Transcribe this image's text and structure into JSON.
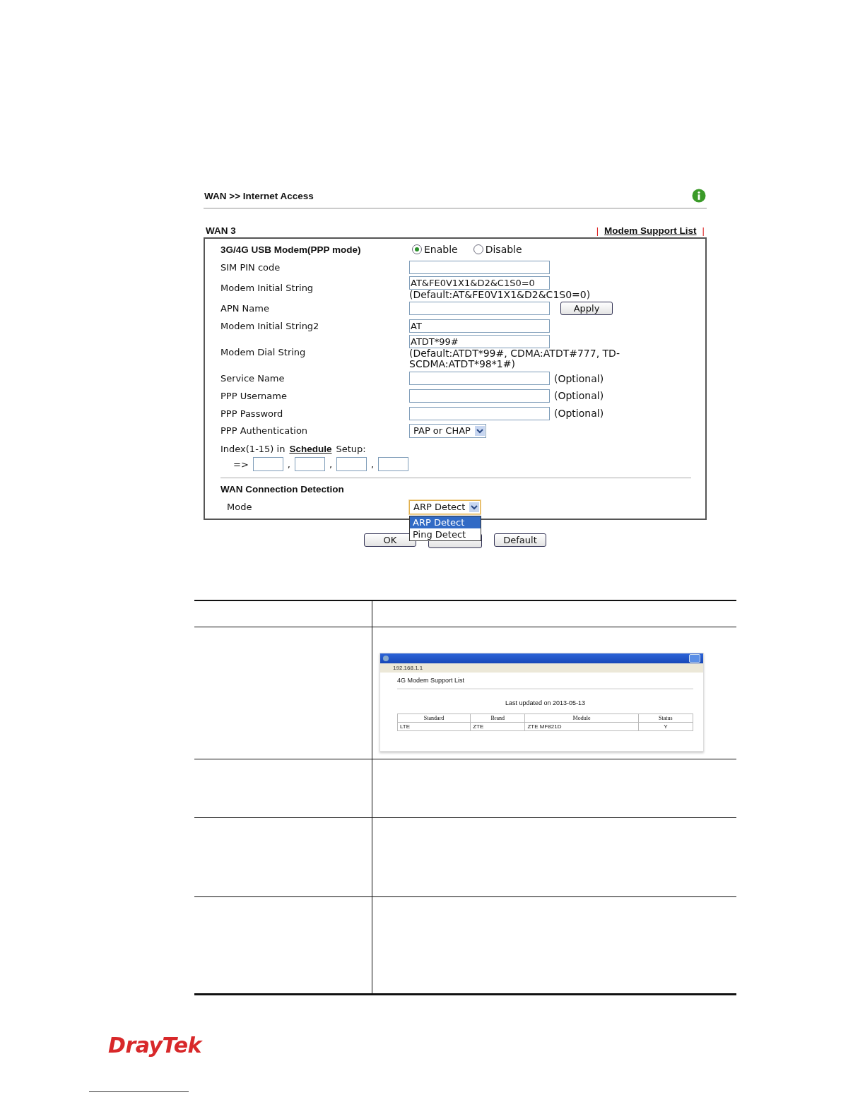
{
  "header": {
    "title": "WAN >> Internet Access"
  },
  "section": {
    "title": "WAN 3",
    "link": "Modem Support List",
    "divider": "|"
  },
  "modem": {
    "label": "3G/4G USB Modem(PPP mode)",
    "options": [
      {
        "label": "Enable",
        "selected": true
      },
      {
        "label": "Disable",
        "selected": false
      }
    ]
  },
  "fields": [
    {
      "kind": "input",
      "label": "SIM PIN code"
    },
    {
      "kind": "input",
      "label": "Modem Initial String",
      "value": "AT&FE0V1X1&D2&C1S0=0",
      "note": "(Default:AT&FE0V1X1&D2&C1S0=0)"
    },
    {
      "kind": "input",
      "label": "APN Name",
      "button": "Apply"
    },
    {
      "kind": "input",
      "label": "Modem Initial String2",
      "value": "AT"
    },
    {
      "kind": "input",
      "label": "Modem Dial String",
      "value": "ATDT*99#",
      "note": "(Default:ATDT*99#, CDMA:ATDT#777, TD-SCDMA:ATDT*98*1#)"
    },
    {
      "kind": "input",
      "label": "Service Name",
      "suffix": "(Optional)"
    },
    {
      "kind": "input",
      "label": "PPP Username",
      "suffix": "(Optional)"
    },
    {
      "kind": "input",
      "label": "PPP Password",
      "suffix": "(Optional)"
    },
    {
      "kind": "select",
      "label": "PPP Authentication",
      "value": "PAP or CHAP"
    }
  ],
  "schedule": {
    "prefix": "Index(1-15) in",
    "link": "Schedule",
    "suffix": "Setup:",
    "arrow": "=>",
    "separators": [
      ",",
      ",",
      ","
    ]
  },
  "detection": {
    "title": "WAN Connection Detection",
    "label": "Mode",
    "value": "ARP Detect",
    "dropdown": [
      {
        "label": "ARP Detect",
        "selected": true
      },
      {
        "label": "Ping Detect",
        "selected": false
      }
    ]
  },
  "buttons": [
    {
      "kind": "button",
      "label": "OK"
    },
    {
      "kind": "covered"
    },
    {
      "kind": "button",
      "label": "Default"
    }
  ],
  "doc_table": {
    "rows": [
      {
        "kind": "header"
      },
      {
        "kind": "screenshot"
      },
      {
        "kind": "short"
      },
      {
        "kind": "medium"
      },
      {
        "kind": "tall"
      }
    ]
  },
  "inner_screenshot": {
    "address": "192.168.1.1",
    "heading": "4G Modem Support List",
    "updated": "Last updated on 2013-05-13",
    "columns": [
      "Standard",
      "Brand",
      "Module",
      "Status"
    ],
    "rows": [
      [
        "LTE",
        "ZTE",
        "ZTE MF821D",
        "Y"
      ]
    ]
  },
  "footer": {
    "logo": "DrayTek"
  }
}
